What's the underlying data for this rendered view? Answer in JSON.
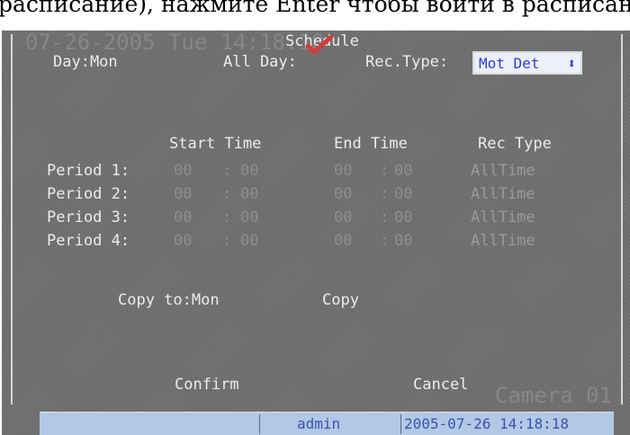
{
  "caption": {
    "text": "расписание), нажмите Enter чтобы войти в расписан"
  },
  "watermark": {
    "datetime": "07-26-2005 Tue 14:18:18",
    "camera": "Camera 01"
  },
  "dialog": {
    "title": "Schedule",
    "day_label": "Day:Mon",
    "all_day_label": "All Day:",
    "rec_type_label": "Rec.Type:",
    "rec_type_value": "Mot  Det",
    "columns": {
      "start": "Start Time",
      "end": "End Time",
      "type": "Rec Type"
    },
    "periods": [
      {
        "label": "Period 1:",
        "start_h": "00",
        "start_m": "00",
        "end_h": "00",
        "end_m": "00",
        "type": "AllTime"
      },
      {
        "label": "Period 2:",
        "start_h": "00",
        "start_m": "00",
        "end_h": "00",
        "end_m": "00",
        "type": "AllTime"
      },
      {
        "label": "Period 3:",
        "start_h": "00",
        "start_m": "00",
        "end_h": "00",
        "end_m": "00",
        "type": "AllTime"
      },
      {
        "label": "Period 4:",
        "start_h": "00",
        "start_m": "00",
        "end_h": "00",
        "end_m": "00",
        "type": "AllTime"
      }
    ],
    "colon": ":",
    "copy_to_label": "Copy to:Mon",
    "copy_button": "Copy",
    "confirm_button": "Confirm",
    "cancel_button": "Cancel"
  },
  "statusbar": {
    "user": "admin",
    "datetime": "2005-07-26 14:18:18"
  },
  "colors": {
    "check": "#d23b3b",
    "select_text": "#2d3dd2",
    "statusbar": "#b1c9e5"
  }
}
